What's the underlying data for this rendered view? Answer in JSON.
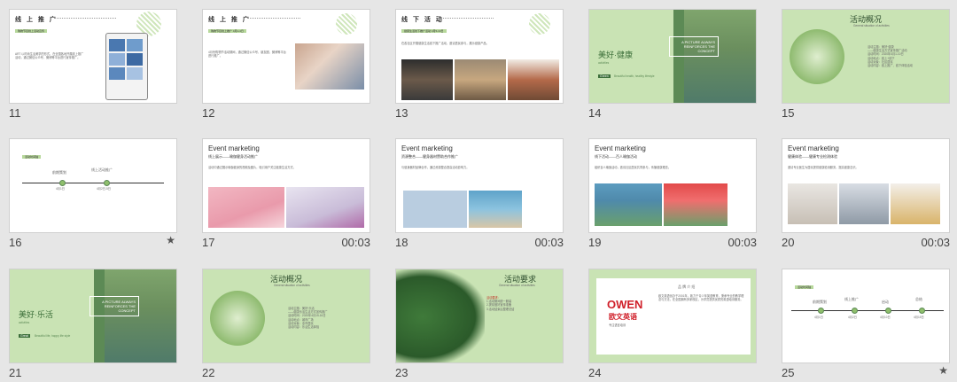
{
  "colors": {
    "background": "#e6e6e6",
    "accent_green": "#c9e3b4",
    "dark_green": "#5c8a55"
  },
  "slides": [
    {
      "num": "11",
      "title": "线 上 推 广",
      "sub": "购物节目线上活动宣传",
      "body": "ART 以时尚生活美学的形式，在全国各地开展线上推广活动，通过微信公众号、微博等平台进行宣传推广。"
    },
    {
      "num": "12",
      "title": "线 上 推 广",
      "sub": "购物节目线上推广 4月1-4日",
      "body": "4月份购物节活动期间，通过微信公众号、朋友圈、微博等平台进行推广。"
    },
    {
      "num": "13",
      "title": "线 下 活 动",
      "sub": "健康生活线下推广活动 4月5-10日",
      "body": "在各社区开展健康生活线下推广活动，邀请居民参与，展示健康产品。"
    },
    {
      "num": "14",
      "title": "美好·健康",
      "sub": "activities",
      "tag": "Green",
      "tagline": "Beautiful health, healthy lifestyle",
      "box": "A PICTURE ALWAYS REINFORCES THE CONCEPT"
    },
    {
      "num": "15",
      "title": "活动概况",
      "sub": "General situation of activities",
      "lines": [
        "活动主题：美好·健康",
        "——健康生活方式宣传推广活动",
        "活动时间：2020年4月1-10日",
        "活动地点：线上+线下",
        "活动对象：社区居民",
        "活动内容：线上推广、线下体验活动"
      ]
    },
    {
      "num": "16",
      "pill": "活动时间轴",
      "labels": [
        "前期策划",
        "线上活动推广",
        "线下活动开展"
      ],
      "dates": [
        "4月1日",
        "4月2日-5日",
        "4月6日-10日"
      ]
    },
    {
      "num": "17",
      "duration": "00:03",
      "title": "Event marketing",
      "sub": "线上展示——瑜伽健身活动推广",
      "body": "活动中通过展示瑜伽健身的视频及图片，吸引用户关注健康生活方式。"
    },
    {
      "num": "18",
      "duration": "00:03",
      "title": "Event marketing",
      "sub": "资源整合——健身器材赞助合作推广",
      "body": "与健身器材品牌合作，通过资源整合提高活动影响力。"
    },
    {
      "num": "19",
      "duration": "00:03",
      "title": "Event marketing",
      "sub": "线下活动——百人瑜伽活动",
      "body": "组织百人瑜伽活动，邀请社区居民共同参与，传播健康理念。"
    },
    {
      "num": "20",
      "duration": "00:03",
      "title": "Event marketing",
      "sub": "健康体验——健康专业检测体验",
      "body": "邀请专业医生为居民提供健康检测服务，提高健康意识。"
    },
    {
      "num": "21",
      "title": "美好·乐活",
      "sub": "activities",
      "tag": "Great",
      "tagline": "Beautiful life, happy life style",
      "box": "A PICTURE ALWAYS REINFORCES THE CONCEPT"
    },
    {
      "num": "22",
      "title": "活动概况",
      "sub": "General situation of activities",
      "lines": [
        "活动主题：美好·乐活",
        "——健康乐活生活方式宣传推广",
        "活动时间：2020年4月15-16日",
        "活动地点：城市广场",
        "活动对象：全市居民",
        "活动内容：乐活生活体验"
      ]
    },
    {
      "num": "23",
      "title": "活动要求",
      "sub": "General situation of activities",
      "lines": [
        "活动要求：",
        "1.活动期间统一服装",
        "2.提前做好宣传准备",
        "3.活动结束后整理总结"
      ]
    },
    {
      "num": "24",
      "logo": "OWEN",
      "logo_cn": "欧文英语",
      "logo_tag": "专注语言培训",
      "head": "品 牌 介 绍",
      "body": "欧文英语创办于2001年，致力于青少年英语教育，秉承专业的教学理念与方法，在全国拥有多家校区，为学员提供优质的英语培训服务。"
    },
    {
      "num": "25",
      "pill": "活动时间轴",
      "labels": [
        "前期策划",
        "线上推广",
        "启动",
        "总结"
      ],
      "dates": [
        "4月1日",
        "4月2日",
        "4月10日",
        "4月15日"
      ]
    }
  ]
}
